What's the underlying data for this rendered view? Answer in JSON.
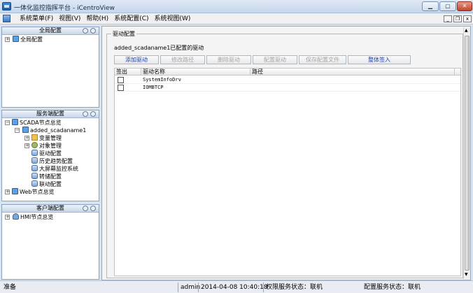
{
  "window": {
    "title": "一体化监控指挥平台 - iCentroView",
    "min_label": "▁",
    "max_label": "▢",
    "close_label": "✕"
  },
  "menu": {
    "items": [
      "系统菜单(F)",
      "视图(V)",
      "帮助(H)",
      "系统配置(C)",
      "系统视图(W)"
    ],
    "mdi_min": "_",
    "mdi_restore": "❐",
    "mdi_close": "x"
  },
  "left": {
    "global_panel": {
      "title": "全局配置",
      "items": [
        "全局配置"
      ]
    },
    "server_panel": {
      "title": "服务端配置",
      "scada_root": "SCADA节点总览",
      "scada_node": "added_scadaname1",
      "children": [
        "变量管理",
        "对象管理",
        "驱动配置",
        "历史趋势配置",
        "大屏幕监控系统",
        "转储配置",
        "联动配置"
      ],
      "web_root": "Web节点总览"
    },
    "client_panel": {
      "title": "客户端配置",
      "hmi_root": "HMI节点总览"
    }
  },
  "main": {
    "group_title": "驱动配置",
    "description": "added_scadaname1已配置的驱动",
    "buttons": [
      {
        "label": "添加驱动",
        "enabled": true
      },
      {
        "label": "修改路径",
        "enabled": false
      },
      {
        "label": "删除驱动",
        "enabled": false
      },
      {
        "label": "配置驱动",
        "enabled": false
      },
      {
        "label": "保存配置文件",
        "enabled": false
      },
      {
        "label": "整体签入",
        "enabled": true
      }
    ],
    "table": {
      "columns": [
        "签出",
        "驱动名称",
        "路径"
      ],
      "rows": [
        {
          "checked": false,
          "name": "SystemInfoDrv",
          "path": ""
        },
        {
          "checked": false,
          "name": "IOMBTCP",
          "path": ""
        }
      ]
    }
  },
  "status": {
    "ready": "准备",
    "user": "admin",
    "datetime": "2014-04-08 10:40:18",
    "auth_service": "权限服务状态：联机",
    "config_service": "配置服务状态：联机"
  },
  "colors": {
    "accent": "#1d3fa8",
    "panel_border": "#8aa2c0"
  }
}
